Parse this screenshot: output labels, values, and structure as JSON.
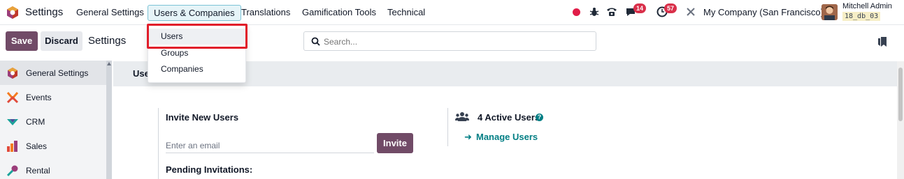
{
  "navbar": {
    "app_title": "Settings",
    "menus": [
      {
        "label": "General Settings"
      },
      {
        "label": "Users & Companies"
      },
      {
        "label": "Translations"
      },
      {
        "label": "Gamification Tools"
      },
      {
        "label": "Technical"
      }
    ],
    "systray": {
      "discuss_badge": "14",
      "activity_badge": "57",
      "company": "My Company (San Francisco)",
      "user_name": "Mitchell Admin",
      "db_name": "18_db_03"
    }
  },
  "control_panel": {
    "save_label": "Save",
    "discard_label": "Discard",
    "title": "Settings",
    "search_placeholder": "Search..."
  },
  "sidebar": {
    "items": [
      {
        "label": "General Settings",
        "icon": "odoo-logo-icon"
      },
      {
        "label": "Events",
        "icon": "events-icon"
      },
      {
        "label": "CRM",
        "icon": "crm-icon"
      },
      {
        "label": "Sales",
        "icon": "sales-icon"
      },
      {
        "label": "Rental",
        "icon": "rental-icon"
      }
    ]
  },
  "dropdown": {
    "items": [
      {
        "label": "Users"
      },
      {
        "label": "Groups"
      },
      {
        "label": "Companies"
      }
    ]
  },
  "main": {
    "section_title": "Users",
    "invite": {
      "title": "Invite New Users",
      "email_placeholder": "Enter an email",
      "invite_label": "Invite",
      "pending_title": "Pending Invitations:"
    },
    "active_users": {
      "label": "4 Active Users",
      "help": "?",
      "manage_label": "Manage Users"
    }
  },
  "colors": {
    "primary": "#714b67",
    "accent": "#017e84",
    "highlight": "#e11d2a"
  }
}
